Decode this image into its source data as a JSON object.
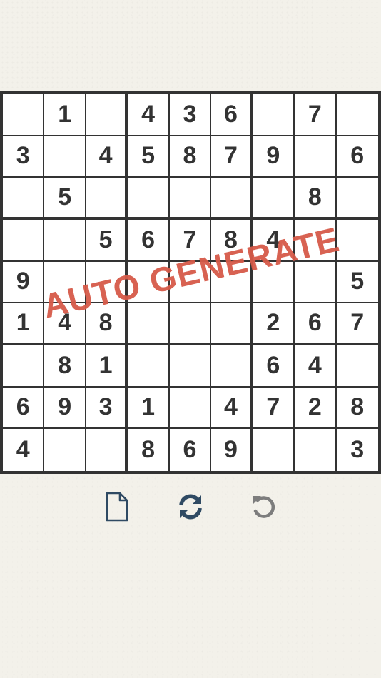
{
  "board": {
    "grid": [
      [
        "",
        "1",
        "",
        "4",
        "3",
        "6",
        "",
        "7",
        ""
      ],
      [
        "3",
        "",
        "4",
        "5",
        "8",
        "7",
        "9",
        "",
        "6"
      ],
      [
        "",
        "5",
        "",
        "",
        "",
        "",
        "",
        "8",
        ""
      ],
      [
        "",
        "",
        "5",
        "6",
        "7",
        "8",
        "4",
        "",
        ""
      ],
      [
        "9",
        "",
        "",
        "",
        "",
        "",
        "",
        "",
        "5"
      ],
      [
        "1",
        "4",
        "8",
        "",
        "",
        "",
        "2",
        "6",
        "7"
      ],
      [
        "",
        "8",
        "1",
        "",
        "",
        "",
        "6",
        "4",
        ""
      ],
      [
        "6",
        "9",
        "3",
        "1",
        "",
        "4",
        "7",
        "2",
        "8"
      ],
      [
        "4",
        "",
        "",
        "8",
        "6",
        "9",
        "",
        "",
        "3"
      ]
    ]
  },
  "overlay": {
    "stamp_text": "AUTO GENERATE",
    "stamp_color": "#d65a49"
  },
  "toolbar": {
    "buttons": [
      {
        "name": "new-puzzle-button",
        "icon": "document-icon",
        "color": "#2f4a63"
      },
      {
        "name": "regenerate-button",
        "icon": "refresh-icon",
        "color": "#2f4a63"
      },
      {
        "name": "undo-button",
        "icon": "undo-icon",
        "color": "#7d7d7d"
      }
    ]
  },
  "colors": {
    "background": "#f3f1ea",
    "grid_line": "#333333",
    "digit": "#333333"
  }
}
